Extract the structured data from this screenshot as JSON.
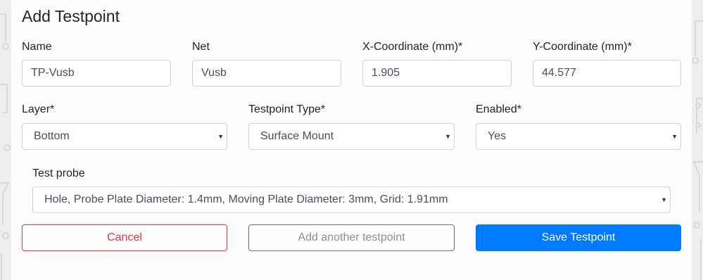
{
  "dialog": {
    "title": "Add Testpoint"
  },
  "fields": {
    "name": {
      "label": "Name",
      "value": "TP-Vusb"
    },
    "net": {
      "label": "Net",
      "value": "Vusb"
    },
    "x_coord": {
      "label": "X-Coordinate (mm)*",
      "value": "1.905"
    },
    "y_coord": {
      "label": "Y-Coordinate (mm)*",
      "value": "44.577"
    },
    "layer": {
      "label": "Layer*",
      "selected": "Bottom"
    },
    "testpoint_type": {
      "label": "Testpoint Type*",
      "selected": "Surface Mount"
    },
    "enabled": {
      "label": "Enabled*",
      "selected": "Yes"
    },
    "test_probe": {
      "label": "Test probe",
      "selected": "Hole, Probe Plate Diameter: 1.4mm, Moving Plate Diameter: 3mm, Grid: 1.91mm"
    }
  },
  "buttons": {
    "cancel": "Cancel",
    "add_another": "Add another testpoint",
    "save": "Save Testpoint"
  },
  "icons": {
    "dropdown": "caret-down-icon"
  },
  "colors": {
    "primary": "#007bff",
    "danger": "#dc3545",
    "secondary": "#6c757d"
  }
}
